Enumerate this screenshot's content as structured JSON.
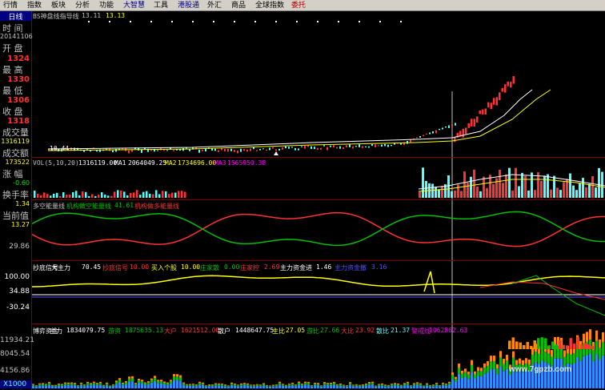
{
  "menu": {
    "items": [
      "行情",
      "指数",
      "板块",
      "分析",
      "功能",
      "大智慧",
      "工具",
      "港股通",
      "外汇",
      "商品",
      "全球指数",
      "委托"
    ]
  },
  "sidebar": {
    "tab": "日线",
    "time_label": "时 间",
    "time_value": "20141106",
    "open_label": "开 盘",
    "open_value": "1324",
    "high_label": "最 高",
    "high_value": "1330",
    "low_label": "最 低",
    "low_value": "1306",
    "close_label": "收 盘",
    "close_value": "1318",
    "volume_label": "成交量",
    "volume_value": "1316119",
    "amount_label": "成交额",
    "amount_value": "173522",
    "change_label": "涨 幅",
    "change_value": "-0.60",
    "turnover_label": "换手率",
    "turnover_value": "1.34",
    "current_label": "当前值",
    "current_value": "13.27"
  },
  "main_chart": {
    "title": "BS神盘线指导线",
    "value1": "13.11",
    "value2": "13.13",
    "low_marker": "10.44"
  },
  "volume_panel": {
    "label": "VOL(5,10,20)",
    "vol": "1316119.00",
    "ma1_label": "MA1",
    "ma1": "2064049.25",
    "ma2_label": "MA2",
    "ma2": "1734696.00",
    "ma3_label": "MA3",
    "ma3": "1565950.38"
  },
  "power_panel": {
    "title": "多空能量线",
    "inst_label": "机构做空能量线",
    "inst_value": "41.61",
    "long_label": "机构做多能量线",
    "axis_value": "29.86"
  },
  "bottom_signal": {
    "title": "抄底信号",
    "main_force_label": "大主力",
    "main_force": "70.45",
    "bottom_signal_label": "抄底信号",
    "bottom_signal": "10.00",
    "buy_label": "买入个股",
    "buy": "10.00",
    "dealer_label": "庄家散",
    "dealer": "0.00",
    "dealer_ctrl_label": "庄家控",
    "dealer_ctrl": "2.69",
    "fund_in_label": "主力资金进",
    "fund_in": "1.46",
    "fund_out_label": "主力资金撤",
    "fund_out": "3.16",
    "axis_top": "100.00",
    "axis_mid": "34.88",
    "axis_bottom": "-30.24"
  },
  "game_panel": {
    "title": "博弈资金",
    "main_label": "主力",
    "main": "1834079.75",
    "hot_label": "游资",
    "hot": "1875635.13",
    "big_label": "大户",
    "big": "1621512.00",
    "retail_label": "散户",
    "retail": "1448647.75",
    "main_ratio_label": "主比",
    "main_ratio": "27.05",
    "hot_ratio_label": "游比",
    "hot_ratio": "27.66",
    "big_ratio_label": "大比",
    "big_ratio": "23.92",
    "retail_ratio_label": "散比",
    "retail_ratio": "21.37",
    "alert_label": "警戒线",
    "alert": "1062862.63",
    "axis1": "11934.21",
    "axis2": "8045.54",
    "axis3": "4156.86",
    "zoom": "X1000"
  },
  "watermark": "www.7gpzb.com",
  "colors": {
    "up": "#ff3232",
    "down": "#54ffff",
    "yellow": "#ffff00",
    "white": "#ffffff",
    "magenta": "#ff00ff",
    "green": "#00c000",
    "blue": "#5050ff",
    "grid": "#800000"
  }
}
